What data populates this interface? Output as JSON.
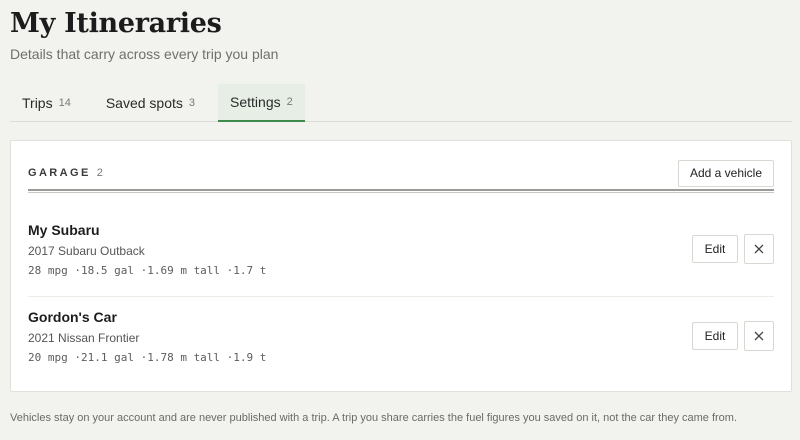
{
  "header": {
    "title": "My Itineraries",
    "subtitle": "Details that carry across every trip you plan"
  },
  "tabs": [
    {
      "label": "Trips",
      "count": "14"
    },
    {
      "label": "Saved spots",
      "count": "3"
    },
    {
      "label": "Settings",
      "count": "2"
    }
  ],
  "active_tab": "Settings",
  "garage": {
    "title": "GARAGE",
    "count": "2",
    "add_label": "Add a vehicle",
    "vehicles": [
      {
        "name": "My Subaru",
        "model": "2017 Subaru Outback",
        "specs": "28 mpg ·18.5 gal ·1.69 m tall ·1.7 t",
        "edit_label": "Edit"
      },
      {
        "name": "Gordon's Car",
        "model": "2021 Nissan Frontier",
        "specs": "20 mpg ·21.1 gal ·1.78 m tall ·1.9 t",
        "edit_label": "Edit"
      }
    ]
  },
  "footnote": "Vehicles stay on your account and are never published with a trip. A trip you share carries the fuel figures you saved on it, not the car they came from.",
  "colors": {
    "background": "#f2f2ee",
    "accent": "#3f8a4f",
    "active_tab_bg": "#e6eee6"
  },
  "icons": {
    "delete": "close-icon"
  }
}
